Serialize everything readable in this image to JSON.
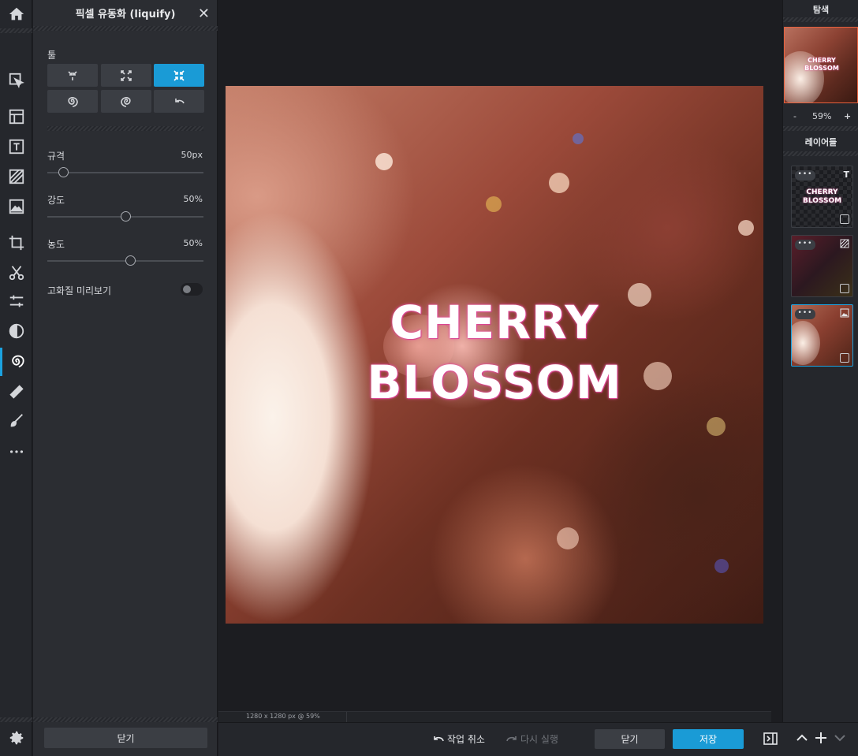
{
  "panel": {
    "title": "픽셀 유동화 (liquify)",
    "tools_label": "툴",
    "params": [
      {
        "label": "규격",
        "value": "50px",
        "fraction": 0.1
      },
      {
        "label": "강도",
        "value": "50%",
        "fraction": 0.5
      },
      {
        "label": "농도",
        "value": "50%",
        "fraction": 0.53
      }
    ],
    "hq_preview_label": "고화질 미리보기",
    "hq_preview_on": false,
    "close_label": "닫기",
    "tools": [
      {
        "name": "push-tool",
        "active": false
      },
      {
        "name": "expand-tool",
        "active": false
      },
      {
        "name": "shrink-tool",
        "active": true
      },
      {
        "name": "twirl-left-tool",
        "active": false
      },
      {
        "name": "twirl-right-tool",
        "active": false
      },
      {
        "name": "restore-tool",
        "active": false
      }
    ]
  },
  "canvas": {
    "title_line1": "CHERRY",
    "title_line2": "BLOSSOM",
    "size_info": "1280 x 1280 px @ 59%"
  },
  "bottom": {
    "undo_label": "작업 취소",
    "redo_label": "다시 실행",
    "close_label": "닫기",
    "save_label": "저장"
  },
  "right": {
    "navigator_label": "탐색",
    "zoom_minus": "-",
    "zoom_value": "59%",
    "zoom_plus": "+",
    "layers_label": "레이어들",
    "thumb_line1": "CHERRY",
    "thumb_line2": "BLOSSOM",
    "layers": [
      {
        "type": "text",
        "active": false,
        "line1": "CHERRY",
        "line2": "BLOSSOM"
      },
      {
        "type": "pattern",
        "active": false
      },
      {
        "type": "image",
        "active": true
      }
    ]
  },
  "colors": {
    "accent": "#1a9bd6",
    "title_glow": "#e64f9c",
    "nav_border": "#e8613d"
  }
}
